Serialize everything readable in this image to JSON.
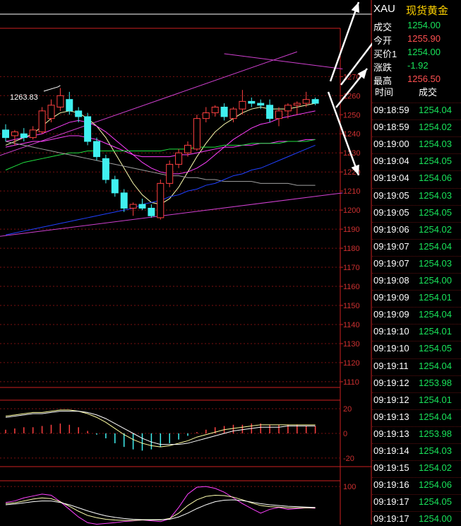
{
  "chart_data": [
    {
      "type": "candlestick",
      "title": "",
      "price_axis": {
        "range": [
          1107,
          1302
        ],
        "ticks": [
          1270,
          1260,
          1250,
          1240,
          1230,
          1220,
          1210,
          1200,
          1190,
          1180,
          1170,
          1160,
          1150,
          1140,
          1130,
          1120,
          1110
        ]
      },
      "annotations": [
        {
          "text": "1263.83",
          "value": 1263.83
        }
      ],
      "candles": [
        {
          "o": 1242,
          "h": 1245,
          "l": 1236,
          "c": 1238
        },
        {
          "o": 1239,
          "h": 1242,
          "l": 1234,
          "c": 1241
        },
        {
          "o": 1240,
          "h": 1243,
          "l": 1236,
          "c": 1238
        },
        {
          "o": 1238,
          "h": 1244,
          "l": 1237,
          "c": 1242
        },
        {
          "o": 1241,
          "h": 1254,
          "l": 1240,
          "c": 1252
        },
        {
          "o": 1248,
          "h": 1258,
          "l": 1246,
          "c": 1255
        },
        {
          "o": 1254,
          "h": 1264,
          "l": 1252,
          "c": 1260
        },
        {
          "o": 1258,
          "h": 1262,
          "l": 1250,
          "c": 1252
        },
        {
          "o": 1252,
          "h": 1254,
          "l": 1246,
          "c": 1249
        },
        {
          "o": 1249,
          "h": 1251,
          "l": 1234,
          "c": 1236
        },
        {
          "o": 1236,
          "h": 1238,
          "l": 1226,
          "c": 1228
        },
        {
          "o": 1227,
          "h": 1229,
          "l": 1214,
          "c": 1216
        },
        {
          "o": 1216,
          "h": 1218,
          "l": 1207,
          "c": 1209
        },
        {
          "o": 1209,
          "h": 1211,
          "l": 1199,
          "c": 1201
        },
        {
          "o": 1201,
          "h": 1204,
          "l": 1197,
          "c": 1203
        },
        {
          "o": 1203,
          "h": 1206,
          "l": 1200,
          "c": 1201
        },
        {
          "o": 1201,
          "h": 1203,
          "l": 1196,
          "c": 1197
        },
        {
          "o": 1196,
          "h": 1216,
          "l": 1195,
          "c": 1214
        },
        {
          "o": 1214,
          "h": 1226,
          "l": 1212,
          "c": 1224
        },
        {
          "o": 1224,
          "h": 1232,
          "l": 1222,
          "c": 1230
        },
        {
          "o": 1230,
          "h": 1236,
          "l": 1228,
          "c": 1234
        },
        {
          "o": 1232,
          "h": 1250,
          "l": 1231,
          "c": 1248
        },
        {
          "o": 1248,
          "h": 1254,
          "l": 1246,
          "c": 1251
        },
        {
          "o": 1251,
          "h": 1255,
          "l": 1249,
          "c": 1254
        },
        {
          "o": 1254,
          "h": 1256,
          "l": 1247,
          "c": 1249
        },
        {
          "o": 1248,
          "h": 1254,
          "l": 1246,
          "c": 1253
        },
        {
          "o": 1253,
          "h": 1263,
          "l": 1250,
          "c": 1257
        },
        {
          "o": 1257,
          "h": 1259,
          "l": 1254,
          "c": 1256
        },
        {
          "o": 1256,
          "h": 1258,
          "l": 1253,
          "c": 1255
        },
        {
          "o": 1255,
          "h": 1258,
          "l": 1246,
          "c": 1248
        },
        {
          "o": 1248,
          "h": 1254,
          "l": 1244,
          "c": 1252
        },
        {
          "o": 1252,
          "h": 1256,
          "l": 1248,
          "c": 1255
        },
        {
          "o": 1255,
          "h": 1257,
          "l": 1250,
          "c": 1256
        },
        {
          "o": 1256,
          "h": 1262,
          "l": 1254,
          "c": 1258
        },
        {
          "o": 1258,
          "h": 1259,
          "l": 1255,
          "c": 1256
        }
      ],
      "moving_averages": [
        {
          "color": "#ffffb0",
          "values": [
            1234,
            1236,
            1238,
            1240,
            1244,
            1248,
            1251,
            1252,
            1251,
            1248,
            1244,
            1238,
            1230,
            1222,
            1214,
            1208,
            1204,
            1203,
            1206,
            1212,
            1220,
            1228,
            1235,
            1241,
            1245,
            1248,
            1251,
            1253,
            1254,
            1253,
            1253,
            1253,
            1254,
            1255,
            1256
          ]
        },
        {
          "color": "#ff40ff",
          "values": [
            1236,
            1237,
            1238,
            1239,
            1240,
            1242,
            1244,
            1246,
            1247,
            1246,
            1244,
            1241,
            1237,
            1233,
            1229,
            1225,
            1222,
            1220,
            1219,
            1219,
            1220,
            1222,
            1225,
            1229,
            1233,
            1237,
            1240,
            1243,
            1245,
            1246,
            1248,
            1249,
            1250,
            1251,
            1252
          ]
        },
        {
          "color": "#ff40ff",
          "values": [
            1233,
            1234,
            1235,
            1236,
            1236,
            1237,
            1238,
            1239,
            1239,
            1238,
            1237,
            1235,
            1233,
            1231,
            1229,
            1228,
            1228,
            1228,
            1228,
            1229,
            1229,
            1230,
            1231,
            1232,
            1233,
            1233,
            1234,
            1234,
            1235,
            1235,
            1236,
            1236,
            1236,
            1237,
            1237
          ]
        },
        {
          "color": "#20e040",
          "values": [
            1221,
            1223,
            1225,
            1226,
            1227,
            1228,
            1229,
            1230,
            1230,
            1231,
            1231,
            1231,
            1231,
            1231,
            1231,
            1231,
            1231,
            1231,
            1232,
            1232,
            1232,
            1233,
            1233,
            1233,
            1234,
            1234,
            1234,
            1235,
            1235,
            1235,
            1235,
            1236,
            1236,
            1236,
            1237
          ]
        },
        {
          "color": "#a0a0a0",
          "values": [
            1236,
            1235,
            1234,
            1233,
            1232,
            1231,
            1230,
            1229,
            1228,
            1227,
            1226,
            1225,
            1224,
            1223,
            1222,
            1221,
            1220,
            1219,
            1218,
            1218,
            1217,
            1217,
            1216,
            1216,
            1215,
            1215,
            1215,
            1215,
            1214,
            1214,
            1214,
            1214,
            1213,
            1213,
            1213
          ]
        },
        {
          "color": "#2040ff",
          "values": [
            1187,
            1188,
            1189,
            1190,
            1191,
            1192,
            1193,
            1194,
            1195,
            1196,
            1197,
            1198,
            1199,
            1200,
            1201,
            1203,
            1204,
            1205,
            1207,
            1208,
            1210,
            1211,
            1213,
            1214,
            1216,
            1218,
            1219,
            1221,
            1222,
            1224,
            1226,
            1228,
            1230,
            1232,
            1234
          ]
        }
      ]
    },
    {
      "type": "bar",
      "title": "",
      "axis": {
        "range": [
          -27,
          27
        ],
        "ticks": [
          20,
          0,
          -20
        ]
      },
      "values": [
        3,
        4,
        5,
        5,
        6,
        7,
        8,
        7,
        5,
        2,
        -1,
        -4,
        -8,
        -11,
        -13,
        -14,
        -13,
        -11,
        -8,
        -5,
        -2,
        1,
        3,
        5,
        6,
        7,
        7,
        8,
        8,
        7,
        7,
        7,
        7,
        6,
        6
      ],
      "series": [
        {
          "color": "#ffffa0",
          "values": [
            14,
            15,
            16,
            17,
            17,
            18,
            19,
            19,
            18,
            16,
            13,
            9,
            4,
            -1,
            -5,
            -8,
            -10,
            -11,
            -10,
            -8,
            -6,
            -3,
            -1,
            1,
            3,
            4,
            5,
            6,
            7,
            7,
            7,
            7,
            7,
            7,
            7
          ]
        },
        {
          "color": "#ffffff",
          "values": [
            13,
            14,
            15,
            16,
            16,
            17,
            18,
            18,
            18,
            17,
            15,
            12,
            8,
            4,
            0,
            -4,
            -7,
            -9,
            -9,
            -9,
            -8,
            -6,
            -4,
            -2,
            0,
            2,
            3,
            4,
            5,
            5,
            5,
            6,
            6,
            6,
            6
          ]
        }
      ]
    },
    {
      "type": "line",
      "title": "",
      "axis": {
        "range": [
          0,
          115
        ],
        "ticks": [
          100
        ]
      },
      "series": [
        {
          "color": "#ff40ff",
          "values": [
            58,
            62,
            70,
            75,
            80,
            77,
            60,
            40,
            20,
            5,
            1,
            3,
            5,
            8,
            10,
            12,
            10,
            8,
            15,
            45,
            80,
            98,
            100,
            95,
            85,
            70,
            55,
            42,
            30,
            40,
            45,
            40,
            42,
            44,
            43
          ]
        },
        {
          "color": "#ffffb0",
          "values": [
            55,
            57,
            62,
            67,
            70,
            68,
            60,
            48,
            35,
            24,
            18,
            14,
            12,
            11,
            11,
            12,
            12,
            12,
            16,
            30,
            50,
            65,
            74,
            77,
            76,
            72,
            65,
            57,
            50,
            47,
            46,
            44,
            44,
            44,
            44
          ]
        },
        {
          "color": "#ffffff",
          "values": [
            52,
            54,
            57,
            60,
            62,
            62,
            58,
            52,
            44,
            36,
            29,
            23,
            19,
            16,
            14,
            13,
            13,
            13,
            14,
            20,
            30,
            42,
            52,
            60,
            64,
            65,
            63,
            59,
            55,
            52,
            50,
            48,
            47,
            46,
            45
          ]
        }
      ]
    }
  ],
  "side_panel": {
    "symbol": "XAU",
    "name": "现货黄金",
    "quote": [
      {
        "label": "成交",
        "value": "1254.00",
        "color": "#19e35a"
      },
      {
        "label": "今开",
        "value": "1255.90",
        "color": "#ff5050"
      },
      {
        "label": "买价1",
        "value": "1254.00",
        "color": "#19e35a"
      },
      {
        "label": "涨跌",
        "value": "-1.92",
        "color": "#19e35a"
      },
      {
        "label": "最高",
        "value": "1256.50",
        "color": "#ff5050"
      }
    ],
    "table_headers": {
      "time": "时间",
      "price": "成交"
    },
    "ticks": [
      {
        "time": "09:18:59",
        "price": "1254.04"
      },
      {
        "time": "09:18:59",
        "price": "1254.02"
      },
      {
        "time": "09:19:00",
        "price": "1254.03"
      },
      {
        "time": "09:19:04",
        "price": "1254.05"
      },
      {
        "time": "09:19:04",
        "price": "1254.06"
      },
      {
        "time": "09:19:05",
        "price": "1254.03"
      },
      {
        "time": "09:19:05",
        "price": "1254.05"
      },
      {
        "time": "09:19:06",
        "price": "1254.02"
      },
      {
        "time": "09:19:07",
        "price": "1254.04"
      },
      {
        "time": "09:19:07",
        "price": "1254.03"
      },
      {
        "time": "09:19:08",
        "price": "1254.00"
      },
      {
        "time": "09:19:09",
        "price": "1254.01"
      },
      {
        "time": "09:19:09",
        "price": "1254.04"
      },
      {
        "time": "09:19:10",
        "price": "1254.01"
      },
      {
        "time": "09:19:10",
        "price": "1254.05"
      },
      {
        "time": "09:19:11",
        "price": "1254.04"
      },
      {
        "time": "09:19:12",
        "price": "1253.98"
      },
      {
        "time": "09:19:12",
        "price": "1254.01"
      },
      {
        "time": "09:19:13",
        "price": "1254.04"
      },
      {
        "time": "09:19:13",
        "price": "1253.98"
      },
      {
        "time": "09:19:14",
        "price": "1254.03"
      },
      {
        "time": "09:19:15",
        "price": "1254.02"
      },
      {
        "time": "09:19:16",
        "price": "1254.06"
      },
      {
        "time": "09:19:17",
        "price": "1254.05"
      },
      {
        "time": "09:19:17",
        "price": "1254.00"
      }
    ]
  },
  "colors": {
    "up": "#ff4040",
    "down": "#40f0f0",
    "grid": "#7a1010",
    "border": "#cc2020"
  }
}
